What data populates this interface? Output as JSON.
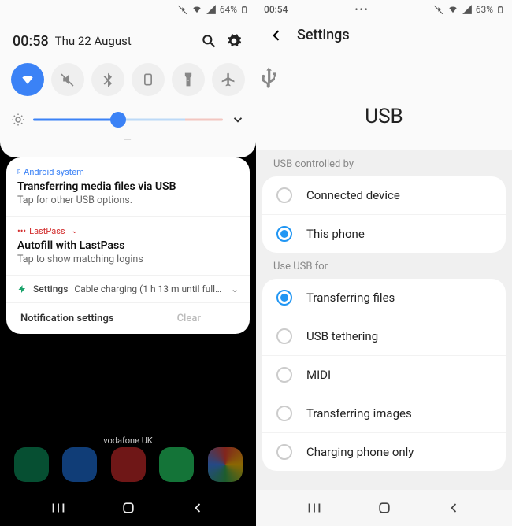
{
  "left": {
    "status": {
      "battery": "64%",
      "icons": [
        "mute",
        "wifi",
        "signal",
        "battery-outline"
      ]
    },
    "shade": {
      "time": "00:58",
      "date": "Thu 22 August",
      "toggles": [
        {
          "name": "wifi",
          "active": true
        },
        {
          "name": "mute",
          "active": false
        },
        {
          "name": "bluetooth",
          "active": false
        },
        {
          "name": "portrait-lock",
          "active": false
        },
        {
          "name": "flashlight",
          "active": false
        },
        {
          "name": "airplane",
          "active": false
        }
      ],
      "brightness_pct": 45
    },
    "notifications": [
      {
        "app": "Android system",
        "app_style": "android",
        "title": "Transferring media files via USB",
        "body": "Tap for other USB options."
      },
      {
        "app": "LastPass",
        "app_style": "lastpass",
        "title": "Autofill with LastPass",
        "body": "Tap to show matching logins"
      }
    ],
    "settings_notif": {
      "label": "Settings",
      "text": "Cable charging (1 h 13 m until fully c…"
    },
    "footer": {
      "notif_settings": "Notification settings",
      "clear": "Clear"
    },
    "carrier": "vodafone UK"
  },
  "right": {
    "status": {
      "time": "00:54",
      "battery": "63%"
    },
    "header": {
      "title": "Settings"
    },
    "hero": {
      "label": "USB"
    },
    "sections": [
      {
        "label": "USB controlled by",
        "options": [
          {
            "label": "Connected device",
            "checked": false
          },
          {
            "label": "This phone",
            "checked": true
          }
        ]
      },
      {
        "label": "Use USB for",
        "options": [
          {
            "label": "Transferring files",
            "checked": true
          },
          {
            "label": "USB tethering",
            "checked": false
          },
          {
            "label": "MIDI",
            "checked": false
          },
          {
            "label": "Transferring images",
            "checked": false
          },
          {
            "label": "Charging phone only",
            "checked": false
          }
        ]
      }
    ]
  }
}
